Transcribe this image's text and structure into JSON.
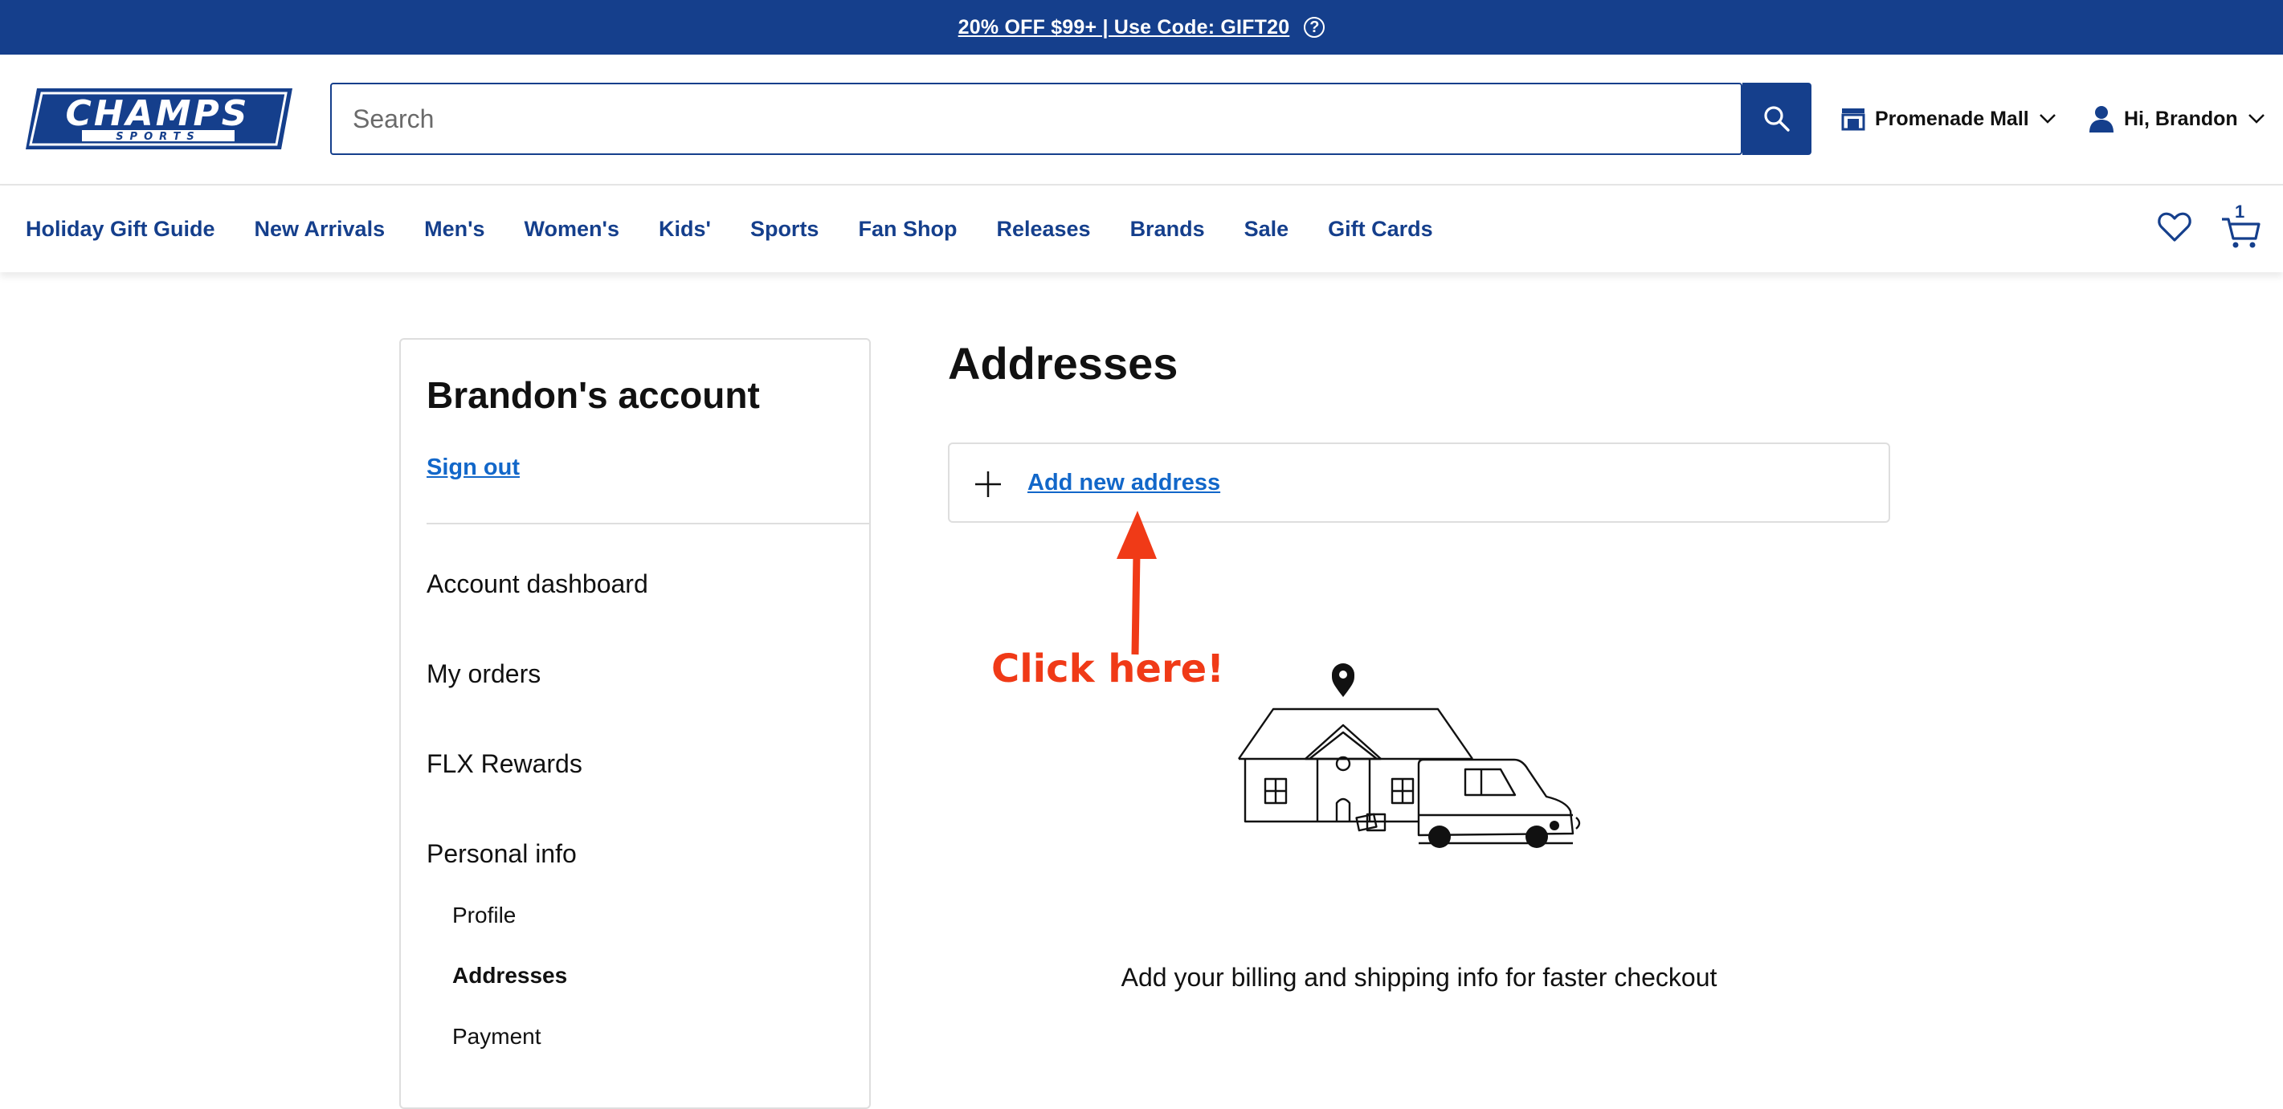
{
  "promo": {
    "text": "20% OFF $99+ | Use Code: GIFT20",
    "help_icon": "question-circle-icon"
  },
  "header": {
    "logo_icon": "champs-sports-logo",
    "search": {
      "placeholder": "Search",
      "value": ""
    },
    "store_label": "Promenade Mall",
    "user_label": "Hi, Brandon"
  },
  "nav": {
    "items": [
      "Holiday Gift Guide",
      "New Arrivals",
      "Men's",
      "Women's",
      "Kids'",
      "Sports",
      "Fan Shop",
      "Releases",
      "Brands",
      "Sale",
      "Gift Cards"
    ],
    "cart_count": "1"
  },
  "sidebar": {
    "title": "Brandon's account",
    "signout": "Sign out",
    "items": [
      "Account dashboard",
      "My orders",
      "FLX Rewards",
      "Personal info"
    ],
    "subitems": [
      "Profile",
      "Addresses",
      "Payment"
    ],
    "active_subitem": "Addresses"
  },
  "main": {
    "title": "Addresses",
    "add_label": "Add new address",
    "annotation": "Click here!",
    "empty_message": "Add your billing and shipping info for faster checkout"
  },
  "colors": {
    "brand_blue": "#153f8c",
    "link_blue": "#1267c9",
    "annotation_red": "#f03a17"
  }
}
